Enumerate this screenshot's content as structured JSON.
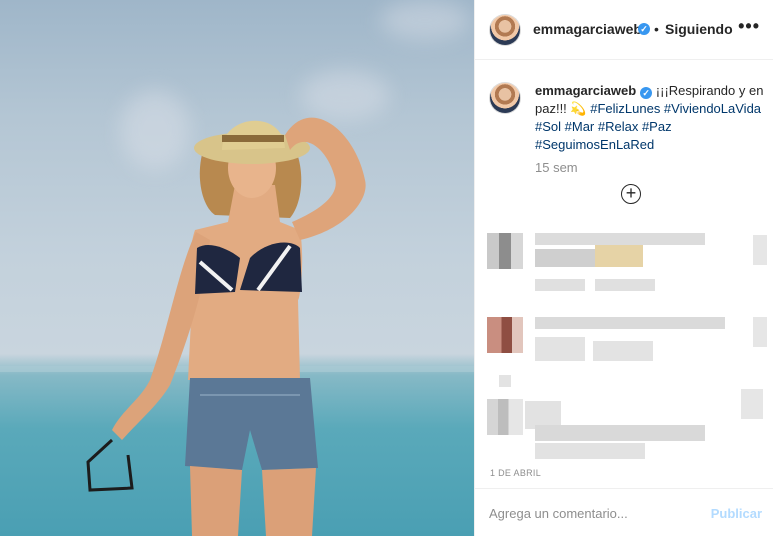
{
  "post": {
    "image_alt": "Woman in straw hat and bikini at the beach",
    "username": "emmagarciaweb",
    "verified_mark": "✓",
    "separator": "•",
    "follow_status": "Siguiendo",
    "more_label": "•••",
    "caption_text": "¡¡¡Respirando y en paz!!! 💫",
    "hashtags": "#FelizLunes #ViviendoLaVida #Sol #Mar #Relax #Paz #SeguimosEnLaRed",
    "time_ago": "15 sem",
    "load_more_label": "+",
    "date": "1 DE ABRIL"
  },
  "composer": {
    "placeholder": "Agrega un comentario...",
    "publish_label": "Publicar"
  },
  "icons": [
    "more-options-icon",
    "verified-badge-icon",
    "load-more-comments-icon"
  ],
  "colors": {
    "link": "#00376b",
    "verified": "#3897f0",
    "muted": "#8e8e8e",
    "publish_disabled": "#b3dbff"
  }
}
